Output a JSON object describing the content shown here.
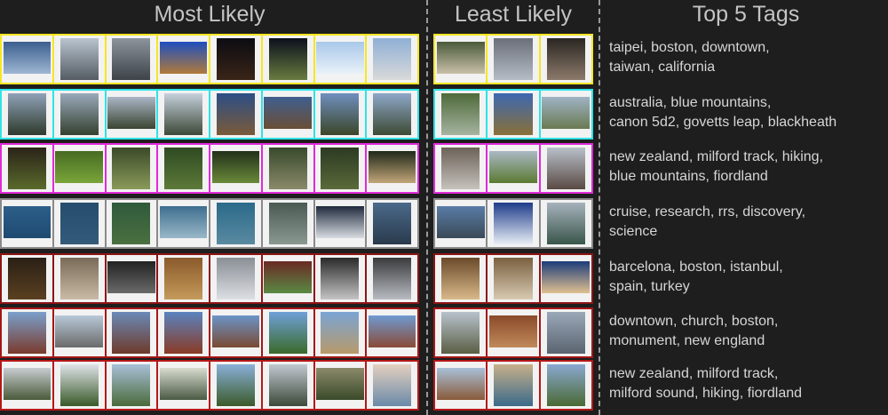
{
  "headers": {
    "most": "Most Likely",
    "least": "Least Likely",
    "tags": "Top 5 Tags"
  },
  "rows": [
    {
      "color": "#f5e623",
      "tags_line1": "taipei, boston, downtown,",
      "tags_line2": "taiwan, california",
      "most": [
        [
          "#3b5f8f",
          "#9fb6d3"
        ],
        [
          "#b9c4cf",
          "#545b63"
        ],
        [
          "#8c949c",
          "#3d4248"
        ],
        [
          "#1e4fbf",
          "#b07a3a"
        ],
        [
          "#0c0c12",
          "#3a2418"
        ],
        [
          "#0b0f1c",
          "#6a7c40"
        ],
        [
          "#a9c8ea",
          "#e9f1f8"
        ],
        [
          "#8fb0d6",
          "#d9d9d9"
        ]
      ],
      "least": [
        [
          "#4a5a3c",
          "#c9c0a8"
        ],
        [
          "#6a6f79",
          "#b6bcc6"
        ],
        [
          "#2a2622",
          "#8c7a6a"
        ]
      ]
    },
    {
      "color": "#2ee3e6",
      "tags_line1": "australia, blue mountains,",
      "tags_line2": "canon 5d2, govetts leap, blackheath",
      "most": [
        [
          "#8fa2b8",
          "#2f3a2c"
        ],
        [
          "#9aa9bb",
          "#34402f"
        ],
        [
          "#aab6c6",
          "#3a4531"
        ],
        [
          "#c5d0dc",
          "#3d4937"
        ],
        [
          "#2c4e86",
          "#7a5a38"
        ],
        [
          "#3f5f8e",
          "#6a4e36"
        ],
        [
          "#6f8fbf",
          "#3b4628"
        ],
        [
          "#8ea7c8",
          "#3d4a34"
        ]
      ],
      "least": [
        [
          "#4e6a3a",
          "#a6b4a0"
        ],
        [
          "#3c68b0",
          "#8a7038"
        ],
        [
          "#9fb3c4",
          "#6a7a52"
        ]
      ]
    },
    {
      "color": "#e02ad8",
      "tags_line1": "new zealand, milford track, hiking,",
      "tags_line2": "blue mountains, fiordland",
      "most": [
        [
          "#2a2318",
          "#5a6a2c"
        ],
        [
          "#476b22",
          "#7aa53a"
        ],
        [
          "#3b4a28",
          "#8a9a5a"
        ],
        [
          "#2f4a22",
          "#5d7a3a"
        ],
        [
          "#22301a",
          "#6a8a3a"
        ],
        [
          "#384a2c",
          "#8a8a6a"
        ],
        [
          "#2c3a22",
          "#5a6a3a"
        ],
        [
          "#1f2818",
          "#c2a67a"
        ]
      ],
      "least": [
        [
          "#6b6258",
          "#c7c2bc"
        ],
        [
          "#aab8c4",
          "#5b7a32"
        ],
        [
          "#b8c0ca",
          "#5a4a44"
        ]
      ]
    },
    {
      "color": "#8a8a8a",
      "tags_line1": "cruise, research, rrs, discovery,",
      "tags_line2": "science",
      "most": [
        [
          "#2d5f8a",
          "#1e4a70"
        ],
        [
          "#274d6e",
          "#345a7a"
        ],
        [
          "#2f5a3c",
          "#4a7040"
        ],
        [
          "#3e6e8e",
          "#9ab8c8"
        ],
        [
          "#2a6a8a",
          "#5a8aa0"
        ],
        [
          "#4a5a52",
          "#8a9890"
        ],
        [
          "#1f2a3c",
          "#d8dce2"
        ],
        [
          "#4a6a8a",
          "#2a3a4c"
        ]
      ],
      "least": [
        [
          "#5a7ca8",
          "#3a4a56"
        ],
        [
          "#1f3c8a",
          "#e8eef6"
        ],
        [
          "#a6b2bc",
          "#39564a"
        ]
      ]
    },
    {
      "color": "#8c1414",
      "tags_line1": "barcelona, boston, istanbul,",
      "tags_line2": "spain, turkey",
      "most": [
        [
          "#2a2016",
          "#5a4020"
        ],
        [
          "#7a6a58",
          "#c9bba6"
        ],
        [
          "#222222",
          "#6a6a6a"
        ],
        [
          "#8a5a2c",
          "#c59a5a"
        ],
        [
          "#8a8f96",
          "#dcdfe3"
        ],
        [
          "#6a2a24",
          "#5a8a44"
        ],
        [
          "#2a2a2a",
          "#c4c4c4"
        ],
        [
          "#3a3a3c",
          "#b8bcc2"
        ]
      ],
      "least": [
        [
          "#6a4a2a",
          "#d9b98a"
        ],
        [
          "#7a6040",
          "#d8cab2"
        ],
        [
          "#1c3c7a",
          "#e0c090"
        ]
      ]
    },
    {
      "color": "#a51616",
      "tags_line1": "downtown, church, boston,",
      "tags_line2": "monument, new england",
      "most": [
        [
          "#7aa0cc",
          "#7a3a2c"
        ],
        [
          "#b8c8d8",
          "#6a6a6a"
        ],
        [
          "#6a8ab8",
          "#6e3a2a"
        ],
        [
          "#5a84c0",
          "#8a3a24"
        ],
        [
          "#6a94c8",
          "#7a4a34"
        ],
        [
          "#6fa0d8",
          "#3a6a2a"
        ],
        [
          "#7aa4d4",
          "#b89a6a"
        ],
        [
          "#6f9ad2",
          "#8a4a36"
        ]
      ],
      "least": [
        [
          "#b8c2cc",
          "#5a5e44"
        ],
        [
          "#8a4a2a",
          "#c08a5a"
        ],
        [
          "#9aa8b8",
          "#5a6470"
        ]
      ]
    },
    {
      "color": "#b61818",
      "tags_line1": "new zealand, milford track,",
      "tags_line2": "milford sound, hiking, fiordland",
      "most": [
        [
          "#c8ccd0",
          "#4a5a3a"
        ],
        [
          "#dfe3e8",
          "#3a5a2a"
        ],
        [
          "#a8c0d8",
          "#4a6a3a"
        ],
        [
          "#d8dcd0",
          "#4a5a44"
        ],
        [
          "#8ab0d8",
          "#3a5a2a"
        ],
        [
          "#c0c8d0",
          "#3d4a3a"
        ],
        [
          "#8a8a6a",
          "#3a4a2a"
        ],
        [
          "#e4d0c0",
          "#6a8aa8"
        ]
      ],
      "least": [
        [
          "#a8c0d8",
          "#8a5a3a"
        ],
        [
          "#c8b08a",
          "#3a6a8a"
        ],
        [
          "#8aa8d0",
          "#4a6a34"
        ]
      ]
    }
  ]
}
